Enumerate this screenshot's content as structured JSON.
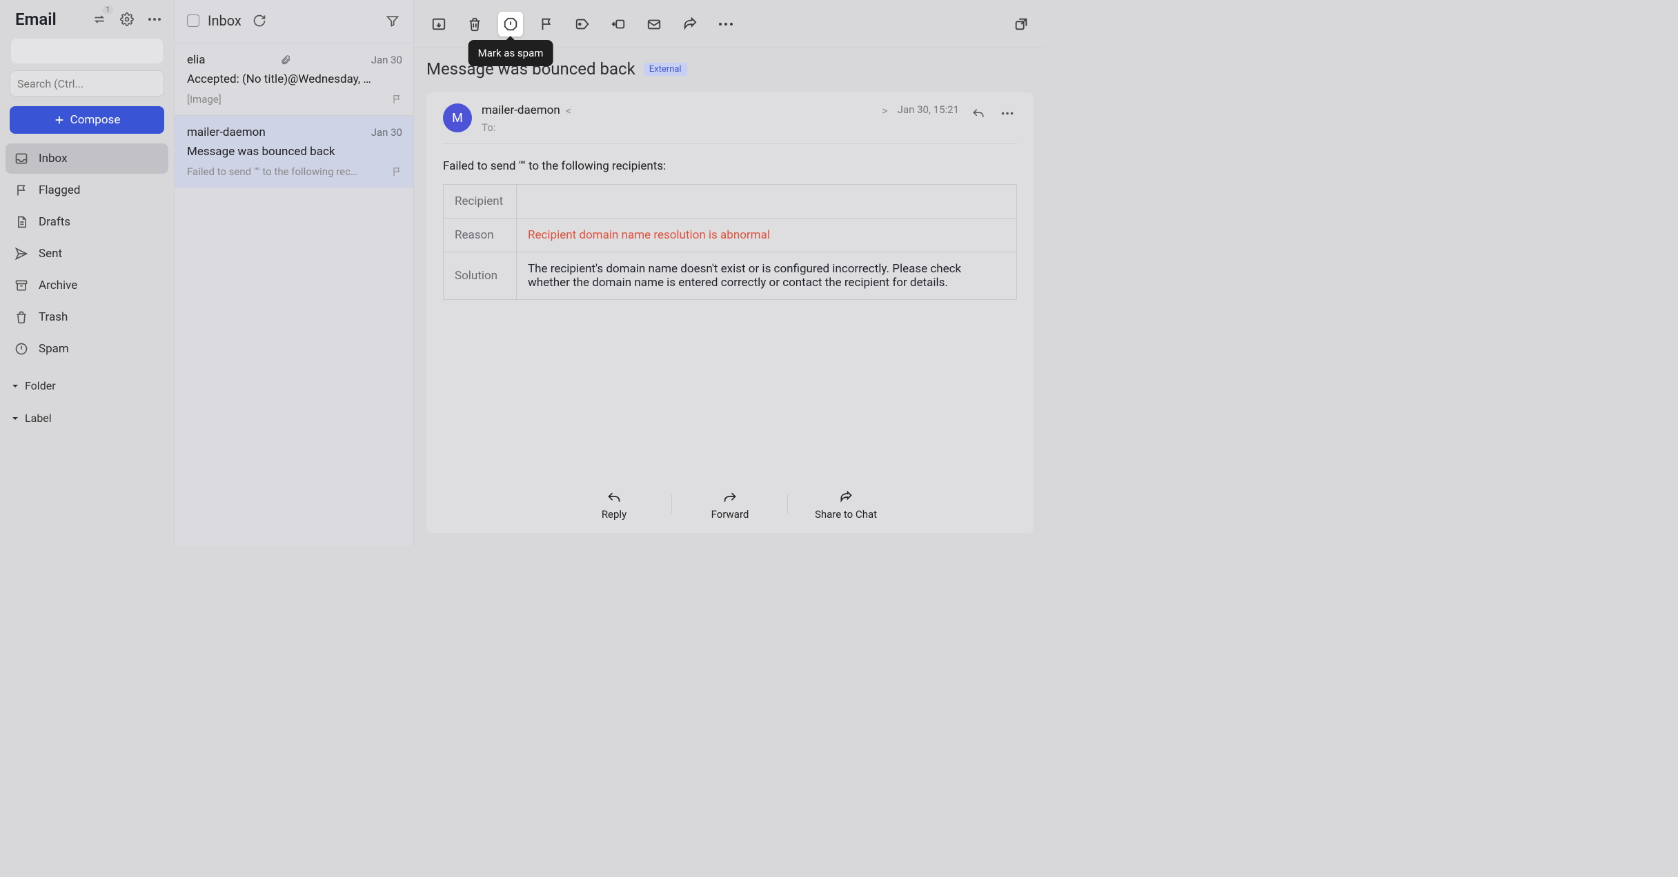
{
  "app": {
    "title": "Email",
    "swap_badge": "1"
  },
  "search": {
    "placeholder": "Search (Ctrl..."
  },
  "compose": "Compose",
  "folders": [
    {
      "key": "inbox",
      "label": "Inbox",
      "icon": "inbox",
      "active": true
    },
    {
      "key": "flagged",
      "label": "Flagged",
      "icon": "flag",
      "active": false
    },
    {
      "key": "drafts",
      "label": "Drafts",
      "icon": "doc",
      "active": false
    },
    {
      "key": "sent",
      "label": "Sent",
      "icon": "send",
      "active": false
    },
    {
      "key": "archive",
      "label": "Archive",
      "icon": "archive",
      "active": false
    },
    {
      "key": "trash",
      "label": "Trash",
      "icon": "trash",
      "active": false
    },
    {
      "key": "spam",
      "label": "Spam",
      "icon": "spam",
      "active": false
    }
  ],
  "sections": {
    "folder": "Folder",
    "label": "Label"
  },
  "list": {
    "title": "Inbox",
    "items": [
      {
        "from": "elia",
        "date": "Jan 30",
        "subject": "Accepted: (No title)@Wednesday, …",
        "snippet": "[Image]",
        "has_attach": true,
        "selected": false
      },
      {
        "from": "mailer-daemon",
        "date": "Jan 30",
        "subject": "Message was bounced back",
        "snippet": "Failed to send \"\" to the following rec…",
        "has_attach": false,
        "selected": true
      }
    ]
  },
  "toolbar": {
    "tooltip": "Mark as spam"
  },
  "reader": {
    "subject": "Message was bounced back",
    "external_badge": "External",
    "from_name": "mailer-daemon",
    "from_open": "<",
    "from_close": ">",
    "to_label": "To:",
    "date": "Jan 30, 15:21",
    "avatar_initial": "M",
    "body_intro": "Failed to send \"\" to the following recipients:",
    "table": {
      "recipient_label": "Recipient",
      "recipient_value": "",
      "reason_label": "Reason",
      "reason_value": "Recipient domain name resolution is abnormal",
      "solution_label": "Solution",
      "solution_value": "The recipient's domain name doesn't exist or is configured incorrectly. Please check whether the domain name is entered correctly or contact the recipient for details."
    },
    "actions": {
      "reply": "Reply",
      "forward": "Forward",
      "share": "Share to Chat"
    }
  }
}
